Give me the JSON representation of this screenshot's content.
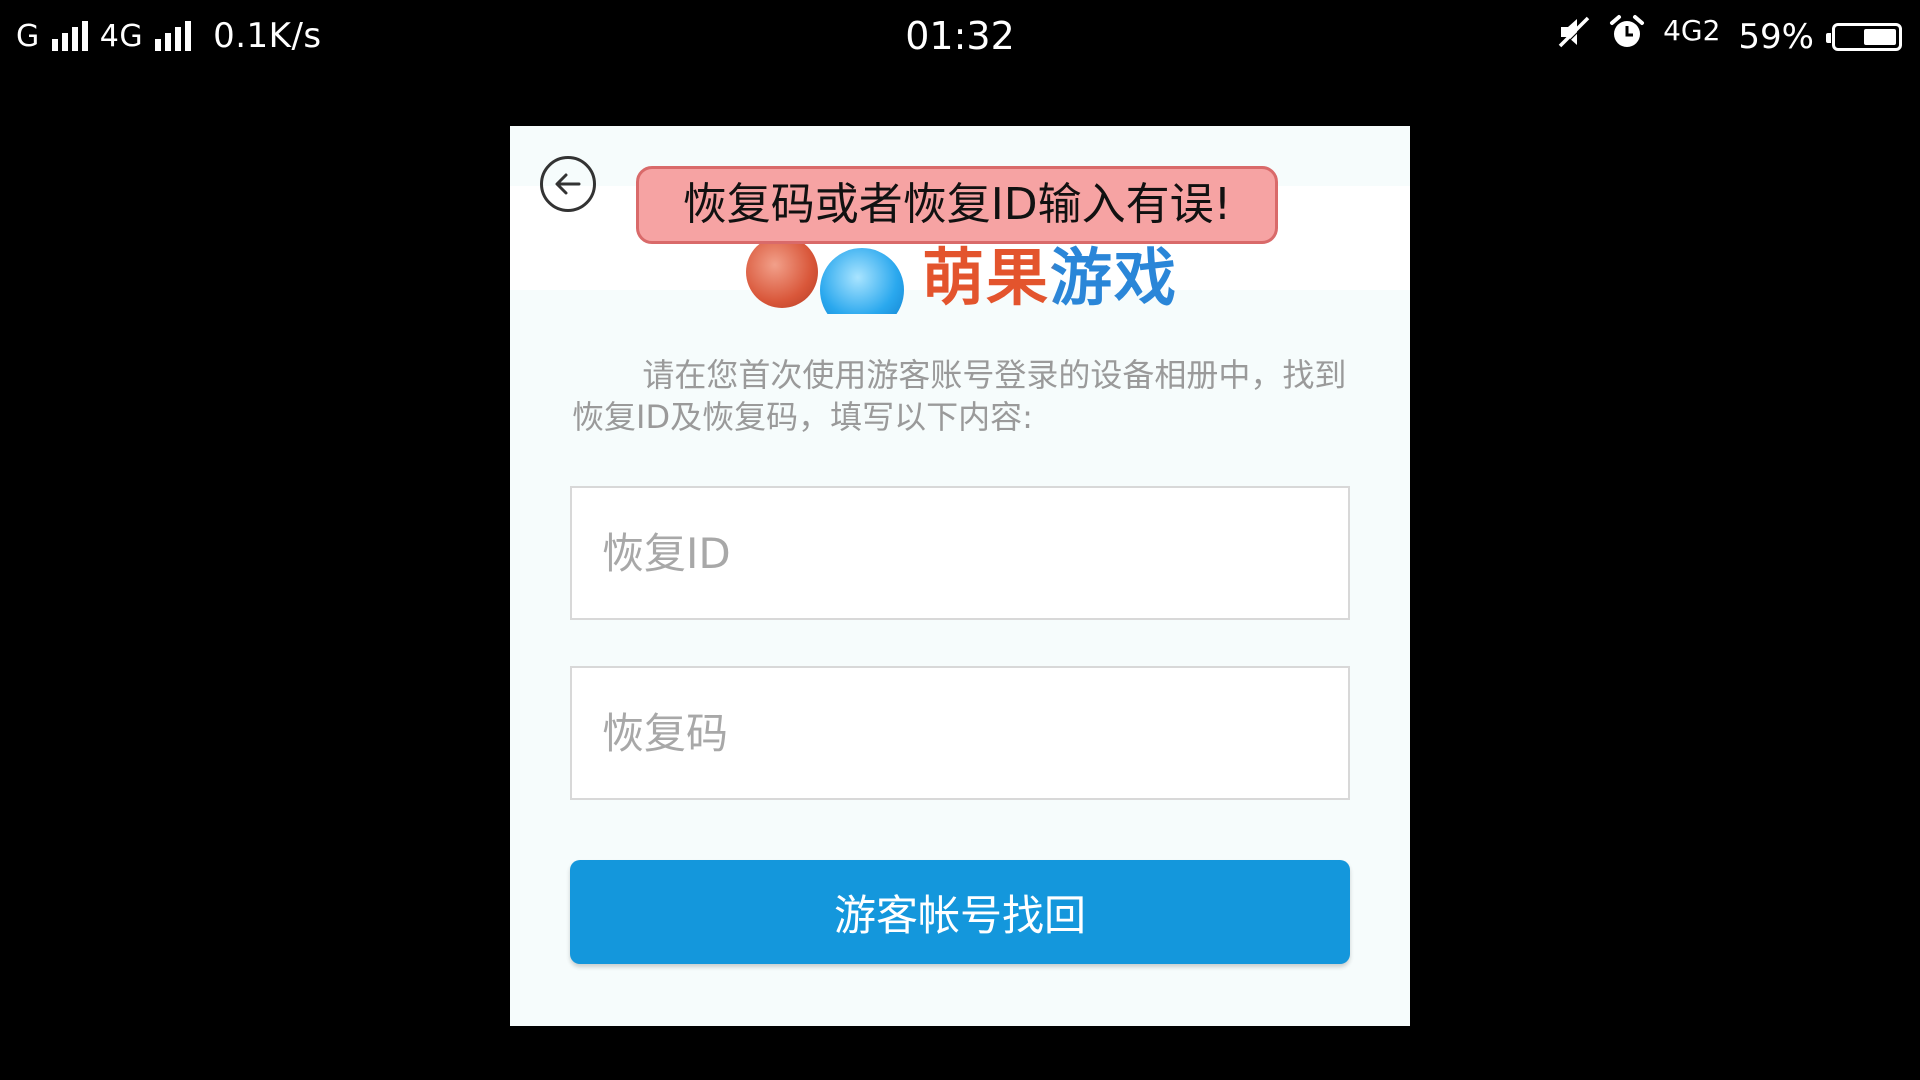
{
  "status_bar": {
    "network_1": "G",
    "network_2": "4G",
    "data_rate": "0.1K/s",
    "time": "01:32",
    "network_3": "4G2",
    "battery_percent": "59%",
    "battery_level": 0.59,
    "icons": [
      "signal-bars-icon",
      "mute-icon",
      "alarm-icon",
      "battery-icon"
    ]
  },
  "dialog": {
    "logo_text": "萌果游戏",
    "error_message": "恢复码或者恢复ID输入有误!",
    "instruction": "请在您首次使用游客账号登录的设备相册中，找到恢复ID及恢复码，填写以下内容:",
    "recovery_id_placeholder": "恢复ID",
    "recovery_code_placeholder": "恢复码",
    "recovery_id_value": "",
    "recovery_code_value": "",
    "submit_label": "游客帐号找回"
  },
  "colors": {
    "background": "#000000",
    "dialog_bg": "#f6fcfc",
    "toast_bg": "#f6a3a3",
    "toast_border": "#d96a6a",
    "button_bg": "#1497dc",
    "text_gray": "#9a9a9a"
  }
}
